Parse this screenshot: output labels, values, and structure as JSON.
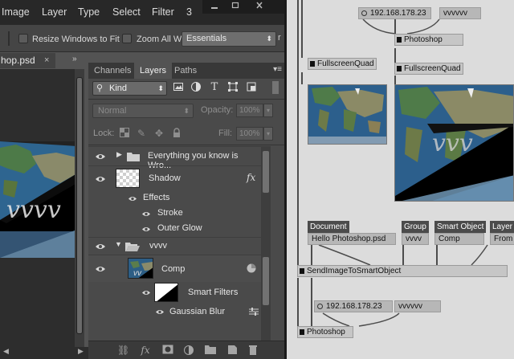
{
  "colors": {
    "ps_dark": "#535353",
    "ps_panel": "#4a4a4a",
    "patch_bg": "#dcdcdc",
    "node_gray": "#c6c6c6",
    "label_dark": "#4b4b4b"
  },
  "menubar": {
    "items": [
      "Image",
      "Layer",
      "Type",
      "Select",
      "Filter",
      "3"
    ],
    "controls": [
      "minimize-icon",
      "restore-icon",
      "close-icon"
    ]
  },
  "options_bar": {
    "resize_windows_label": "Resize Windows to Fit",
    "zoom_all_label": "Zoom All Wi",
    "workspace_value": "Essentials"
  },
  "document": {
    "tab_label": "hop.psd",
    "close_glyph": "×"
  },
  "layers_panel": {
    "tabs": [
      "Channels",
      "Layers",
      "Paths"
    ],
    "active_tab": "Layers",
    "filter_kind": "Kind",
    "blend_mode": "Normal",
    "opacity_label": "Opacity:",
    "opacity_value": "100%",
    "lock_label": "Lock:",
    "fill_label": "Fill:",
    "fill_value": "100%",
    "layers": {
      "group1_name": "Everything you know is Wro...",
      "shadow_name": "Shadow",
      "fx_glyph": "fx",
      "effects_label": "Effects",
      "stroke_label": "Stroke",
      "outer_glow_label": "Outer Glow",
      "group2_name": "vvvv",
      "comp_name": "Comp",
      "smart_filters_label": "Smart Filters",
      "gaussian_blur_label": "Gaussian Blur"
    }
  },
  "patch": {
    "ip_top": "192.168.178.23",
    "name_top": "vvvvvv",
    "photoshop_top": "Photoshop",
    "fullscreen1": "FullscreenQuad",
    "fullscreen2": "FullscreenQuad",
    "pin_document": "Document",
    "pin_group": "Group",
    "pin_smart_object": "Smart Object",
    "pin_layer": "Layer",
    "val_document": "Hello Photoshop.psd",
    "val_group": "vvvv",
    "val_smart_object": "Comp",
    "val_layer": "From",
    "send_node": "SendImageToSmartObject",
    "ip_bottom": "192.168.178.23",
    "name_bottom": "vvvvvv",
    "photoshop_bottom": "Photoshop"
  }
}
